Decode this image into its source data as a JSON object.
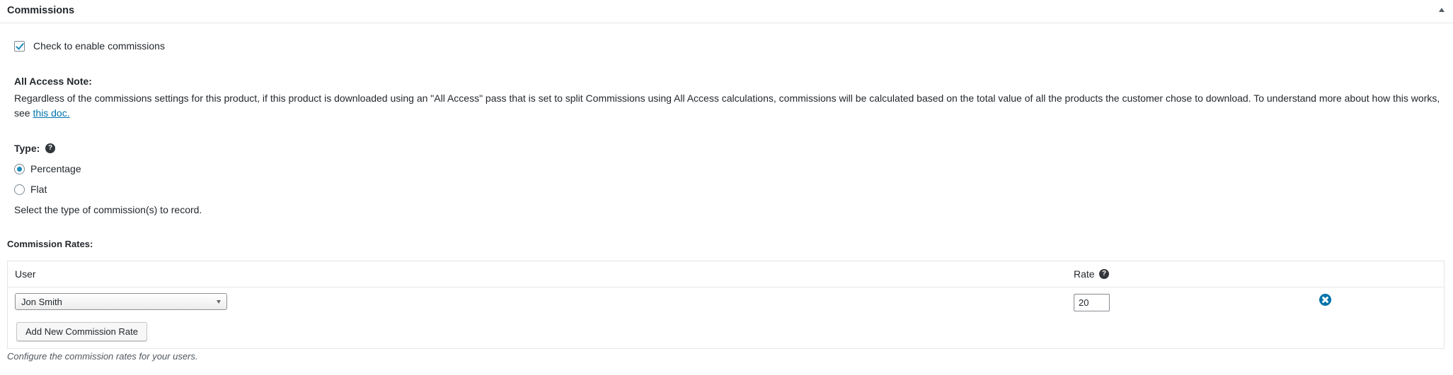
{
  "panel": {
    "title": "Commissions",
    "collapse_icon": "triangle-up-icon"
  },
  "enable": {
    "checked": true,
    "label": "Check to enable commissions"
  },
  "all_access": {
    "heading": "All Access Note:",
    "text": "Regardless of the commissions settings for this product, if this product is downloaded using an \"All Access\" pass that is set to split Commissions using All Access calculations, commissions will be calculated based on the total value of all the products the customer chose to download. To understand more about how this works, see ",
    "link_text": "this doc."
  },
  "type": {
    "label": "Type:",
    "help_icon": "question-circle-icon",
    "options": [
      {
        "label": "Percentage",
        "selected": true
      },
      {
        "label": "Flat",
        "selected": false
      }
    ],
    "description": "Select the type of commission(s) to record."
  },
  "rates": {
    "heading": "Commission Rates:",
    "columns": {
      "user": "User",
      "rate": "Rate"
    },
    "rate_help_icon": "question-circle-icon",
    "rows": [
      {
        "user": "Jon Smith",
        "rate": "20",
        "remove_icon": "remove-circle-icon"
      }
    ],
    "add_button": "Add New Commission Rate",
    "footer_note": "Configure the commission rates for your users."
  },
  "colors": {
    "accent": "#0073aa",
    "text": "#23282d"
  }
}
